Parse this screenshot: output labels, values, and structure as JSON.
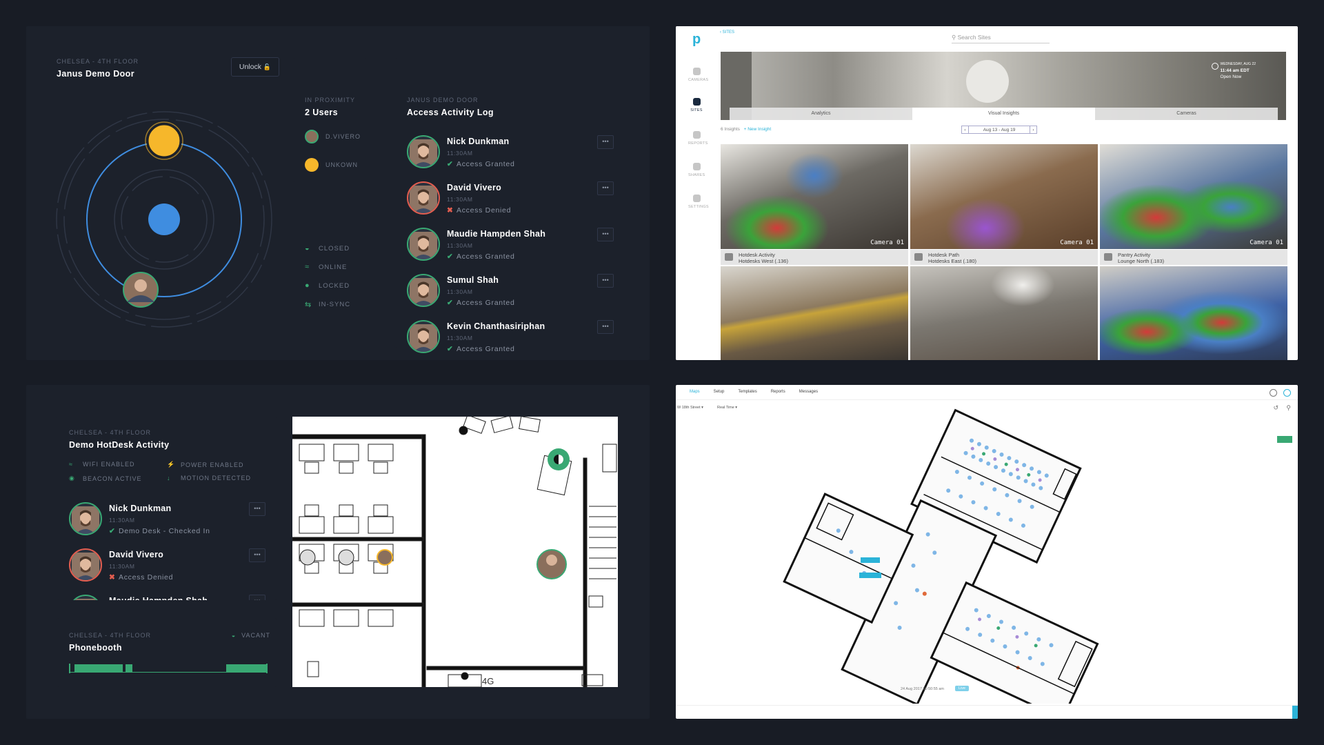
{
  "door": {
    "location": "CHELSEA - 4TH FLOOR",
    "title": "Janus Demo Door",
    "unlock": "Unlock"
  },
  "proximity": {
    "caption": "IN PROXIMITY",
    "count": "2 Users",
    "users": [
      {
        "label": "D.VIVERO"
      },
      {
        "label": "UNKOWN"
      }
    ]
  },
  "status": [
    {
      "icon": "half-circle-icon",
      "label": "CLOSED"
    },
    {
      "icon": "wifi-icon",
      "label": "ONLINE"
    },
    {
      "icon": "lock-icon",
      "label": "LOCKED"
    },
    {
      "icon": "sync-icon",
      "label": "IN-SYNC"
    }
  ],
  "log": {
    "caption": "JANUS DEMO DOOR",
    "title": "Access Activity Log",
    "more": "•••",
    "entries": [
      {
        "name": "Nick Dunkman",
        "time": "11:30AM",
        "status": "Access Granted",
        "granted": true
      },
      {
        "name": "David Vivero",
        "time": "11:30AM",
        "status": "Access Denied",
        "granted": false
      },
      {
        "name": "Maudie Hampden Shah",
        "time": "11:30AM",
        "status": "Access Granted",
        "granted": true
      },
      {
        "name": "Sumul Shah",
        "time": "11:30AM",
        "status": "Access Granted",
        "granted": true
      },
      {
        "name": "Kevin Chanthasiriphan",
        "time": "11:30AM",
        "status": "Access Granted",
        "granted": true
      }
    ]
  },
  "hotdesk": {
    "location": "CHELSEA - 4TH FLOOR",
    "title": "Demo HotDesk Activity",
    "features": [
      "WIFI ENABLED",
      "POWER ENABLED",
      "BEACON ACTIVE",
      "MOTION DETECTED"
    ],
    "entries": [
      {
        "name": "Nick Dunkman",
        "time": "11:30AM",
        "status": "Demo Desk - Checked In",
        "granted": true
      },
      {
        "name": "David Vivero",
        "time": "11:30AM",
        "status": "Access Denied",
        "granted": false
      },
      {
        "name": "Maudie Hampden Shah"
      }
    ]
  },
  "phonebooth": {
    "location": "CHELSEA - 4TH FLOOR",
    "title": "Phonebooth",
    "state": "VACANT"
  },
  "floorplan": {
    "room": "4G"
  },
  "insights": {
    "breadcrumb": "‹ SITES",
    "search": "Search Sites",
    "clock": [
      "WEDNESDAY, AUG 22",
      "11:44 am EDT",
      "Open Now"
    ],
    "nav": [
      "CAMERAS",
      "SITES",
      "REPORTS",
      "SHARES",
      "SETTINGS"
    ],
    "tabs": [
      "Analytics",
      "Visual Insights",
      "Cameras"
    ],
    "count": "6 Insights",
    "new": "+ New Insight",
    "range": "Aug 13 - Aug 19",
    "cards": [
      {
        "title": "Hotdesk Activity",
        "sub": "Hotdesks West (.136)",
        "cam": "Camera 01"
      },
      {
        "title": "Hotdesk Path",
        "sub": "Hotdesks East (.180)",
        "cam": "Camera 01"
      },
      {
        "title": "Pantry Activity",
        "sub": "Lounge North (.183)",
        "cam": "Camera 01"
      }
    ]
  },
  "map": {
    "tabs": [
      "Maps",
      "Setup",
      "Templates",
      "Reports",
      "Messages"
    ],
    "street": "W 18th Street",
    "view": "Real Time",
    "timestamp": "24 Aug 2017 10:50:55 am",
    "live": "Live"
  }
}
